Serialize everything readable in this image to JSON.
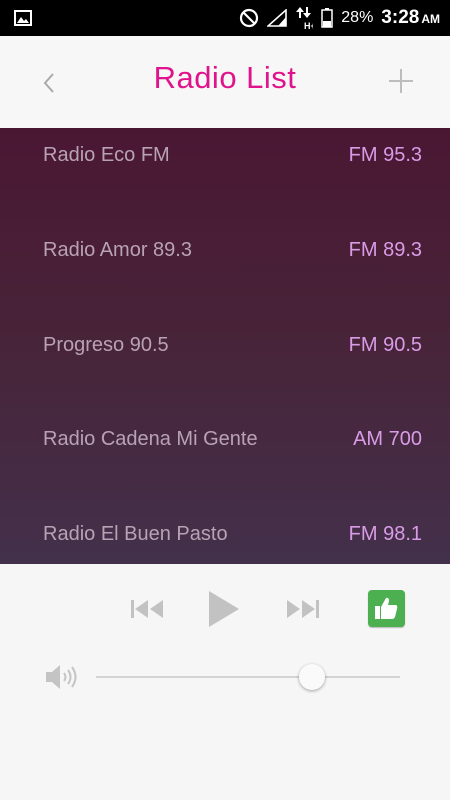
{
  "status_bar": {
    "battery_percent": "28%",
    "time": "3:28",
    "ampm": "AM",
    "icons": [
      "image-icon",
      "do-not-disturb-icon",
      "signal-icon",
      "data-arrows-icon",
      "battery-icon"
    ]
  },
  "header": {
    "title": "Radio List",
    "back_icon": "chevron-left-icon",
    "add_icon": "plus-icon",
    "title_color": "#e0138c"
  },
  "stations": [
    {
      "name": "Radio Eco FM",
      "frequency": "FM 95.3"
    },
    {
      "name": "Radio Amor 89.3",
      "frequency": "FM 89.3"
    },
    {
      "name": "Progreso 90.5",
      "frequency": "FM 90.5"
    },
    {
      "name": "Radio Cadena Mi Gente",
      "frequency": "AM 700"
    },
    {
      "name": "Radio El Buen Pasto",
      "frequency": "FM 98.1"
    }
  ],
  "player": {
    "controls": [
      "previous-icon",
      "play-icon",
      "next-icon",
      "thumbs-up-icon"
    ],
    "volume_level": 0.71,
    "like_color": "#4caf50"
  }
}
